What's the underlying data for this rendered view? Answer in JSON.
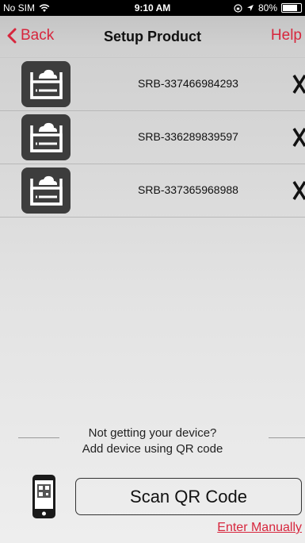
{
  "status_bar": {
    "carrier": "No SIM",
    "time": "9:10 AM",
    "battery": "80%",
    "battery_level": 0.8
  },
  "nav": {
    "back_label": "Back",
    "title": "Setup Product",
    "help_label": "Help"
  },
  "devices": [
    {
      "name": "SRB-337466984293"
    },
    {
      "name": "SRB-336289839597"
    },
    {
      "name": "SRB-337365968988"
    }
  ],
  "hint": {
    "line1": "Not getting your device?",
    "line2": "Add device using QR code"
  },
  "scan_button_label": "Scan QR Code",
  "enter_manually_label": "Enter Manually",
  "colors": {
    "accent": "#d7263d",
    "icon_bg": "#3d3d3d"
  },
  "icons": {
    "back": "chevron-left-icon",
    "device": "cloud-router-icon",
    "remove": "close-icon",
    "phone": "phone-qr-icon"
  }
}
